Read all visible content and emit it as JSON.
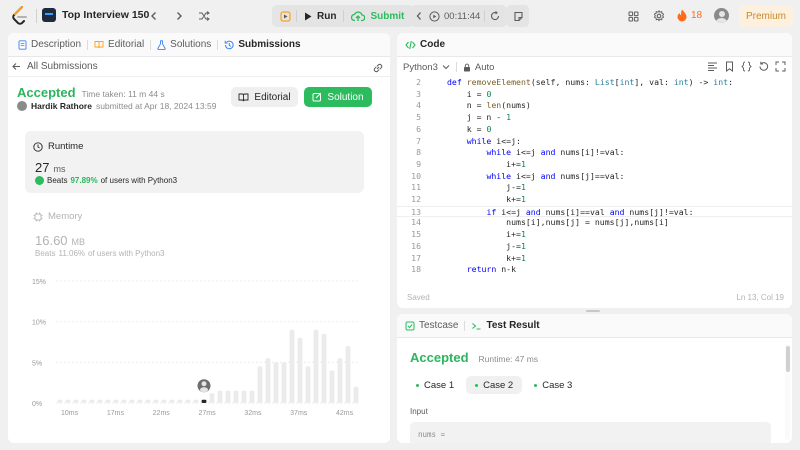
{
  "topbar": {
    "title": "Top Interview 150",
    "run_label": "Run",
    "submit_label": "Submit",
    "timer": "00:11:44",
    "streak_count": "18",
    "premium_label": "Premium"
  },
  "left_panel": {
    "tabs": [
      {
        "label": "Description"
      },
      {
        "label": "Editorial"
      },
      {
        "label": "Solutions"
      },
      {
        "label": "Submissions"
      }
    ],
    "back_label": "All Submissions",
    "status": "Accepted",
    "time_taken": "Time taken: 11 m 44 s",
    "author": "Hardik Rathore",
    "submitted_at": "submitted at Apr 18, 2024 13:59",
    "editorial_button": "Editorial",
    "solution_button": "Solution",
    "runtime": {
      "label": "Runtime",
      "value": "27",
      "unit": "ms",
      "beats_prefix": "Beats",
      "beats_pct": "97.89%",
      "beats_suffix": "of users with Python3"
    },
    "memory": {
      "label": "Memory",
      "value": "16.60",
      "unit": "MB",
      "beats_prefix": "Beats",
      "beats_pct": "11.06%",
      "beats_suffix": "of users with Python3"
    }
  },
  "chart_data": {
    "type": "bar",
    "title": "",
    "xlabel": "",
    "ylabel": "",
    "ylim": [
      0,
      15
    ],
    "y_ticks": [
      "15%",
      "10%",
      "5%",
      "0%"
    ],
    "x_tick_labels": [
      "10ms",
      "17ms",
      "22ms",
      "27ms",
      "32ms",
      "37ms",
      "42ms"
    ],
    "values": [
      0.4,
      0.4,
      0.4,
      0.4,
      0.4,
      0.4,
      0.4,
      0.4,
      0.4,
      0.4,
      0.4,
      0.4,
      0.4,
      0.4,
      0.4,
      0.4,
      0.4,
      0.4,
      0.4,
      1.2,
      1.5,
      1.5,
      1.5,
      1.5,
      1.5,
      4.5,
      5.5,
      5.0,
      5.0,
      9.0,
      8.0,
      4.5,
      9.0,
      8.5,
      4.0,
      5.5,
      7.0,
      2.0
    ],
    "highlight_index": 18,
    "nav_x_tick_labels": [
      "10ms",
      "17ms",
      "22ms",
      "27ms",
      "32ms",
      "37ms",
      "42ms"
    ]
  },
  "code_panel": {
    "tab_label": "Code",
    "language": "Python3",
    "mode": "Auto",
    "saved_label": "Saved",
    "cursor_pos": "Ln 13, Col 19",
    "lines": [
      {
        "n": "2",
        "text": "def removeElement(self, nums: List[int], val: int) -> int:"
      },
      {
        "n": "3",
        "text": "    i = 0"
      },
      {
        "n": "4",
        "text": "    n = len(nums)"
      },
      {
        "n": "5",
        "text": "    j = n - 1"
      },
      {
        "n": "6",
        "text": "    k = 0"
      },
      {
        "n": "7",
        "text": "    while i<=j:"
      },
      {
        "n": "8",
        "text": "        while i<=j and nums[i]!=val:"
      },
      {
        "n": "9",
        "text": "            i+=1"
      },
      {
        "n": "10",
        "text": "        while i<=j and nums[j]==val:"
      },
      {
        "n": "11",
        "text": "            j-=1"
      },
      {
        "n": "12",
        "text": "            k+=1"
      },
      {
        "n": "13",
        "text": "        if i<=j and nums[i]==val and nums[j]!=val:"
      },
      {
        "n": "14",
        "text": "            nums[i],nums[j] = nums[j],nums[i]"
      },
      {
        "n": "15",
        "text": "            i+=1"
      },
      {
        "n": "16",
        "text": "            j-=1"
      },
      {
        "n": "17",
        "text": "            k+=1"
      },
      {
        "n": "18",
        "text": "    return n-k"
      }
    ]
  },
  "test_panel": {
    "tabs": [
      {
        "label": "Testcase"
      },
      {
        "label": "Test Result"
      }
    ],
    "status": "Accepted",
    "runtime": "Runtime: 47 ms",
    "cases": [
      {
        "label": "Case 1"
      },
      {
        "label": "Case 2"
      },
      {
        "label": "Case 3"
      }
    ],
    "input_label": "Input",
    "input_var": "nums ="
  },
  "colors": {
    "accepted": "#2db55d",
    "brand_orange": "#ffa116",
    "solution_button": "#2cbb5d",
    "premium_bg": "#fdf0de",
    "premium_text": "#c98a2b",
    "code_tab_icon": "#2cbb5d"
  }
}
